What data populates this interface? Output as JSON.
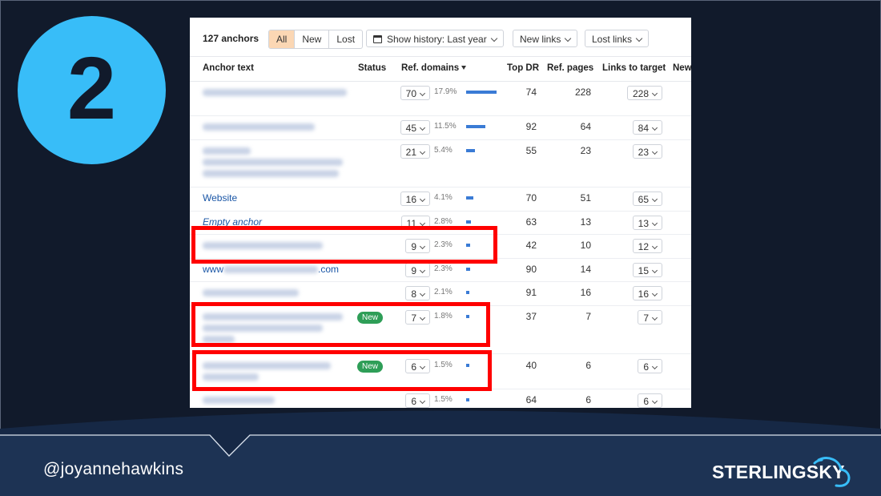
{
  "slide": {
    "step_number": "2",
    "handle": "@joyannehawkins",
    "logo_part1": "STERLING",
    "logo_part2": "SKY",
    "colors": {
      "background": "#111a2b",
      "accent": "#38bdf8",
      "footer": "#1d3354",
      "highlight": "#ff0000"
    }
  },
  "toolbar": {
    "count": "127 anchors",
    "filters": [
      "All",
      "New",
      "Lost"
    ],
    "active_filter": "All",
    "history": "Show history: Last year",
    "new_links": "New links",
    "lost_links": "Lost links"
  },
  "table": {
    "headers": {
      "anchor": "Anchor text",
      "status": "Status",
      "ref_domains": "Ref. domains",
      "top_dr": "Top DR",
      "ref_pages": "Ref. pages",
      "links": "Links to target",
      "new": "New"
    },
    "rows": [
      {
        "anchor": "",
        "status": "",
        "ref_domains": "70",
        "pct": "17.9%",
        "bar": 17.9,
        "top_dr": "74",
        "ref_pages": "228",
        "links": "228"
      },
      {
        "anchor": "",
        "status": "",
        "ref_domains": "45",
        "pct": "11.5%",
        "bar": 11.5,
        "top_dr": "92",
        "ref_pages": "64",
        "links": "84"
      },
      {
        "anchor": "",
        "status": "",
        "ref_domains": "21",
        "pct": "5.4%",
        "bar": 5.4,
        "top_dr": "55",
        "ref_pages": "23",
        "links": "23"
      },
      {
        "anchor": "Website",
        "status": "",
        "ref_domains": "16",
        "pct": "4.1%",
        "bar": 4.1,
        "top_dr": "70",
        "ref_pages": "51",
        "links": "65"
      },
      {
        "anchor": "Empty anchor",
        "status": "",
        "ref_domains": "11",
        "pct": "2.8%",
        "bar": 2.8,
        "top_dr": "63",
        "ref_pages": "13",
        "links": "13"
      },
      {
        "anchor": "",
        "status": "",
        "ref_domains": "9",
        "pct": "2.3%",
        "bar": 2.3,
        "top_dr": "42",
        "ref_pages": "10",
        "links": "12"
      },
      {
        "anchor_prefix": "www",
        "anchor_suffix": ".com",
        "status": "",
        "ref_domains": "9",
        "pct": "2.3%",
        "bar": 2.3,
        "top_dr": "90",
        "ref_pages": "14",
        "links": "15"
      },
      {
        "anchor": "",
        "status": "",
        "ref_domains": "8",
        "pct": "2.1%",
        "bar": 2.1,
        "top_dr": "91",
        "ref_pages": "16",
        "links": "16"
      },
      {
        "anchor": "",
        "status": "New",
        "ref_domains": "7",
        "pct": "1.8%",
        "bar": 1.8,
        "top_dr": "37",
        "ref_pages": "7",
        "links": "7"
      },
      {
        "anchor": "",
        "status": "New",
        "ref_domains": "6",
        "pct": "1.5%",
        "bar": 1.5,
        "top_dr": "40",
        "ref_pages": "6",
        "links": "6"
      },
      {
        "anchor": "",
        "status": "",
        "ref_domains": "6",
        "pct": "1.5%",
        "bar": 1.5,
        "top_dr": "64",
        "ref_pages": "6",
        "links": "6"
      }
    ]
  }
}
